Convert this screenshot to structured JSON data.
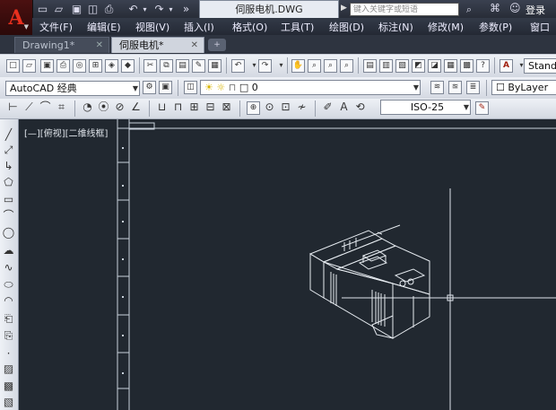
{
  "window": {
    "app_logo": "A",
    "doc_title": "伺服电机.DWG",
    "search_placeholder": "键入关键字或短语",
    "login_label": "登录",
    "quick_access_icons": [
      "new-icon",
      "open-icon",
      "save-icon",
      "saveas-icon",
      "print-icon",
      "undo-icon",
      "redo-icon",
      "more-icon"
    ]
  },
  "menu": {
    "items": [
      "文件(F)",
      "编辑(E)",
      "视图(V)",
      "插入(I)",
      "格式(O)",
      "工具(T)",
      "绘图(D)",
      "标注(N)",
      "修改(M)",
      "参数(P)",
      "窗口"
    ]
  },
  "tabs": [
    {
      "label": "Drawing1*",
      "active": false
    },
    {
      "label": "伺服电机*",
      "active": true
    }
  ],
  "toolbar": {
    "workspace": "AutoCAD 经典",
    "layer": "0",
    "dim_style": "ISO-25",
    "linetype": "ByLayer",
    "text_style": "Stand"
  },
  "viewport": {
    "label": "[—][俯视][二维线框]",
    "background": "#212830"
  }
}
